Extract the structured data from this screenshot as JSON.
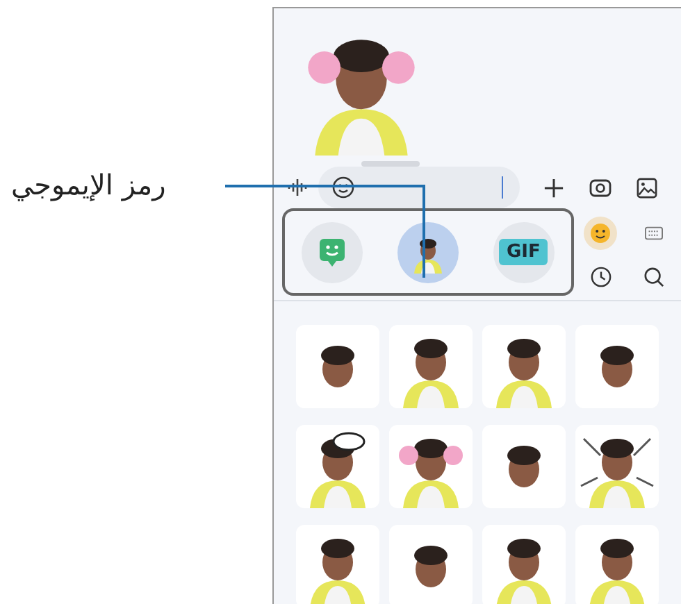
{
  "callout": {
    "label": "رمز الإيموجي"
  },
  "sticker_panel": {
    "tabs": [
      {
        "kind": "sticker_app",
        "selected": false
      },
      {
        "kind": "avatar",
        "selected": true
      },
      {
        "kind": "gif",
        "label": "GIF",
        "selected": false
      }
    ]
  }
}
